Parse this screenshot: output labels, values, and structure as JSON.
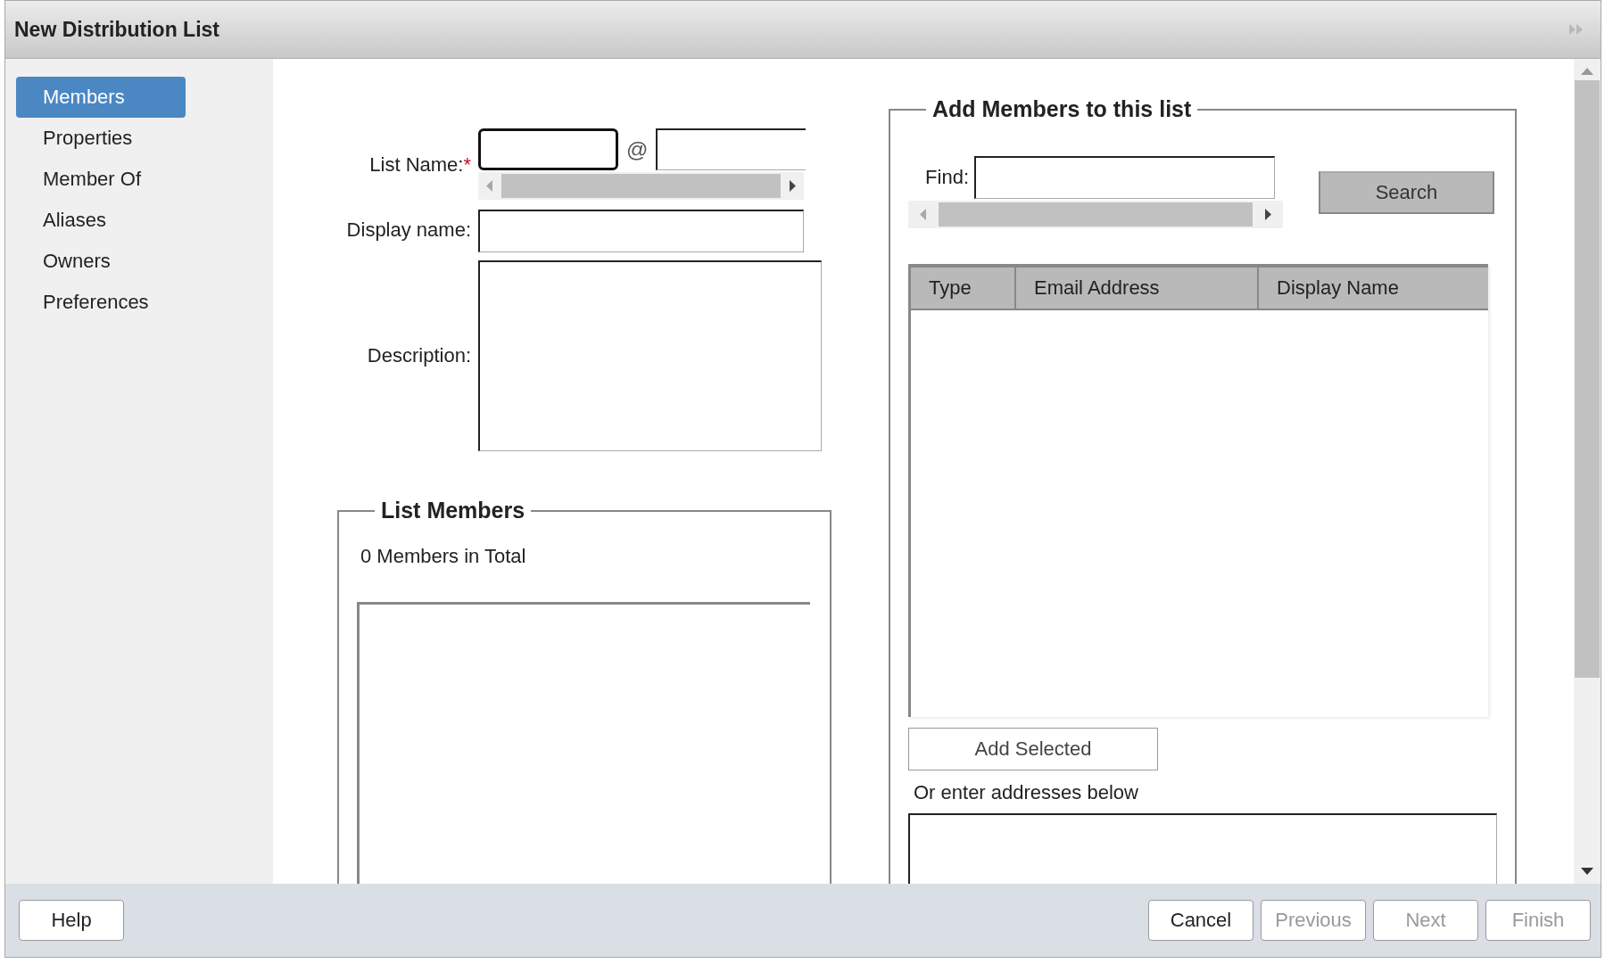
{
  "window": {
    "title": "New Distribution List"
  },
  "sidebar": {
    "items": [
      {
        "label": "Members",
        "selected": true
      },
      {
        "label": "Properties",
        "selected": false
      },
      {
        "label": "Member Of",
        "selected": false
      },
      {
        "label": "Aliases",
        "selected": false
      },
      {
        "label": "Owners",
        "selected": false
      },
      {
        "label": "Preferences",
        "selected": false
      }
    ]
  },
  "form": {
    "list_name_label": "List Name:",
    "required_mark": "*",
    "at_sign": "@",
    "display_name_label": "Display name:",
    "description_label": "Description:"
  },
  "list_members": {
    "legend": "List Members",
    "count": "0 Members in Total"
  },
  "add_members": {
    "legend": "Add Members to this list",
    "find_label": "Find:",
    "search_button": "Search",
    "columns": [
      "Type",
      "Email Address",
      "Display Name"
    ],
    "add_selected_button": "Add Selected",
    "addresses_label": "Or enter addresses below"
  },
  "buttons": [
    {
      "label": "Help",
      "disabled": false,
      "kind": "left"
    },
    {
      "label": "Cancel",
      "disabled": false,
      "kind": "right"
    },
    {
      "label": "Previous",
      "disabled": true,
      "kind": "right"
    },
    {
      "label": "Next",
      "disabled": true,
      "kind": "right"
    },
    {
      "label": "Finish",
      "disabled": true,
      "kind": "right"
    }
  ]
}
